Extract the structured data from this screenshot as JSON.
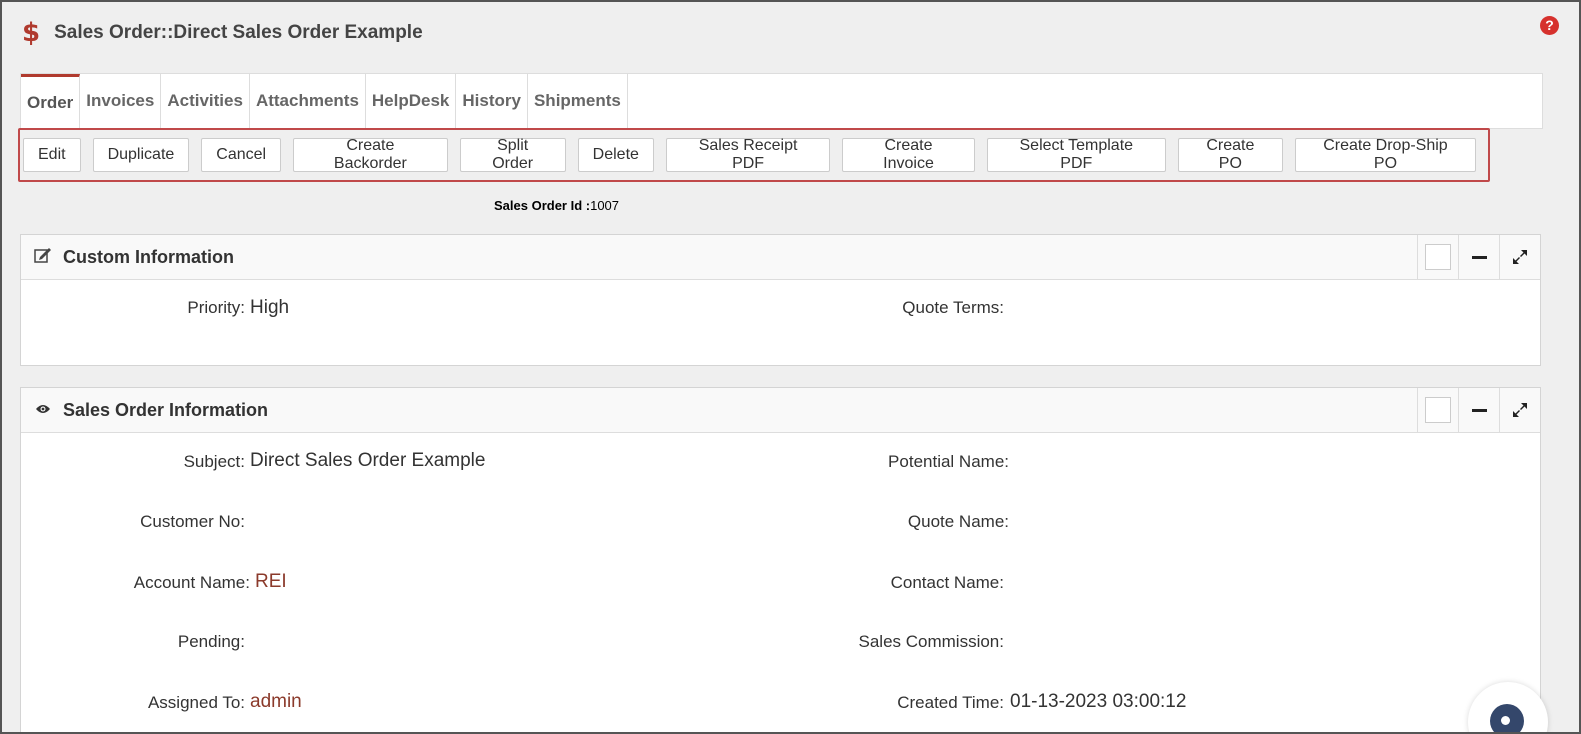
{
  "header": {
    "title": "Sales Order::Direct Sales Order Example",
    "module_icon": "dollar-icon",
    "help_icon": "help-icon"
  },
  "tabs": [
    {
      "label": "Order",
      "active": true
    },
    {
      "label": "Invoices"
    },
    {
      "label": "Activities"
    },
    {
      "label": "Attachments"
    },
    {
      "label": "HelpDesk"
    },
    {
      "label": "History"
    },
    {
      "label": "Shipments"
    }
  ],
  "toolbar": {
    "buttons": [
      "Edit",
      "Duplicate",
      "Cancel",
      "Create Backorder",
      "Split Order",
      "Delete",
      "Sales Receipt PDF",
      "Create Invoice",
      "Select Template PDF",
      "Create PO",
      "Create Drop-Ship PO"
    ]
  },
  "sales_order_id": {
    "label": "Sales Order Id :",
    "value": "1007"
  },
  "custom_info": {
    "title": "Custom Information",
    "icon": "edit-icon",
    "fields": {
      "priority_label": "Priority:",
      "priority_value": "High",
      "quote_terms_label": "Quote Terms:"
    }
  },
  "so_info": {
    "title": "Sales Order Information",
    "icon": "eye-icon",
    "fields": {
      "subject_label": "Subject:",
      "subject_value": "Direct Sales Order Example",
      "potential_label": "Potential Name:",
      "customer_no_label": "Customer No:",
      "quote_name_label": "Quote Name:",
      "account_label": "Account Name:",
      "account_value": "REI",
      "contact_label": "Contact Name:",
      "pending_label": "Pending:",
      "commission_label": "Sales Commission:",
      "assigned_label": "Assigned To:",
      "assigned_value": "admin",
      "created_label": "Created Time:",
      "created_value": "01-13-2023 03:00:12"
    }
  },
  "colors": {
    "accent": "#b03a2e",
    "link": "#8b3a2b",
    "highlight_border": "#c0494a"
  }
}
